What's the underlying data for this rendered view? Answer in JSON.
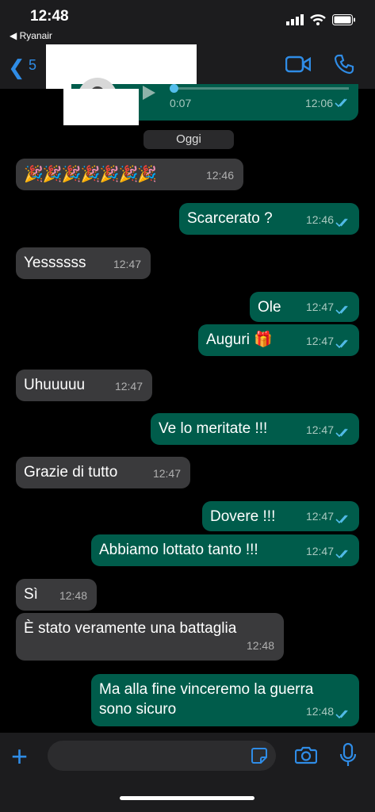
{
  "status_bar": {
    "time": "12:48",
    "back_app": "◀ Ryanair"
  },
  "header": {
    "back_count": "5"
  },
  "voice_note": {
    "duration": "0:07",
    "time": "12:06"
  },
  "day_separator": "Oggi",
  "messages": [
    {
      "dir": "in",
      "text": "🎉🎉🎉🎉🎉🎉🎉",
      "time": "12:46"
    },
    {
      "dir": "out",
      "text": "Scarcerato ?",
      "time": "12:46"
    },
    {
      "dir": "in",
      "text": "Yessssss",
      "time": "12:47"
    },
    {
      "dir": "out",
      "text": "Ole",
      "time": "12:47"
    },
    {
      "dir": "out",
      "text": "Auguri 🎁",
      "time": "12:47"
    },
    {
      "dir": "in",
      "text": "Uhuuuuu",
      "time": "12:47"
    },
    {
      "dir": "out",
      "text": "Ve lo meritate !!!",
      "time": "12:47"
    },
    {
      "dir": "in",
      "text": "Grazie di tutto",
      "time": "12:47"
    },
    {
      "dir": "out",
      "text": "Dovere !!!",
      "time": "12:47"
    },
    {
      "dir": "out",
      "text": "Abbiamo lottato tanto !!!",
      "time": "12:47"
    },
    {
      "dir": "in",
      "text": "Sì",
      "time": "12:48"
    },
    {
      "dir": "in",
      "text": "È stato veramente una battaglia",
      "time": "12:48"
    },
    {
      "dir": "out",
      "text": "Ma alla fine vinceremo la guerra",
      "text2": "sono sicuro",
      "time": "12:48"
    }
  ],
  "colors": {
    "incoming": "#3a3a3c",
    "outgoing": "#005c4b",
    "accent": "#2f8ce6",
    "read_tick": "#53bdeb"
  }
}
